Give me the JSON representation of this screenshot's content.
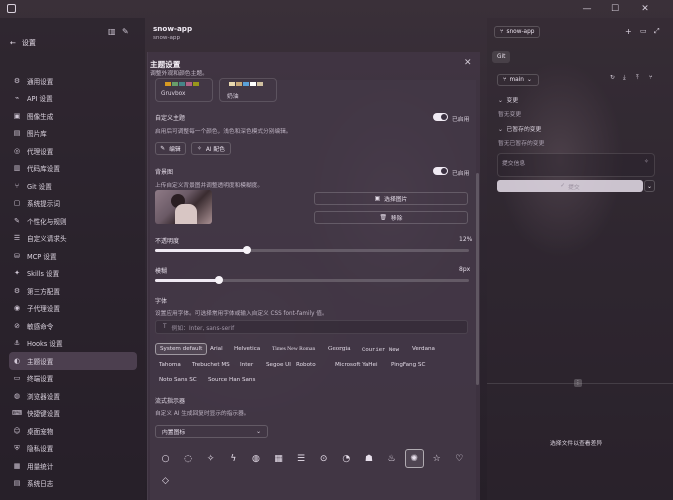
{
  "window": {
    "minimize": "—",
    "maximize": "☐",
    "close": "✕"
  },
  "sidebar": {
    "back_label": "设置",
    "items": [
      {
        "label": "通用设置",
        "icon": "⚙"
      },
      {
        "label": "API 设置",
        "icon": "⌁"
      },
      {
        "label": "图像生成",
        "icon": "▣"
      },
      {
        "label": "图片库",
        "icon": "▤"
      },
      {
        "label": "代理设置",
        "icon": "◎"
      },
      {
        "label": "代码库设置",
        "icon": "▥"
      },
      {
        "label": "Git 设置",
        "icon": "⑂"
      },
      {
        "label": "系统提示词",
        "icon": "▢"
      },
      {
        "label": "个性化与规则",
        "icon": "✎"
      },
      {
        "label": "自定义请求头",
        "icon": "☰"
      },
      {
        "label": "MCP 设置",
        "icon": "⛁"
      },
      {
        "label": "Skills 设置",
        "icon": "✦"
      },
      {
        "label": "第三方配置",
        "icon": "⚙"
      },
      {
        "label": "子代理设置",
        "icon": "◉"
      },
      {
        "label": "敏感命令",
        "icon": "⊘"
      },
      {
        "label": "Hooks 设置",
        "icon": "⚓"
      },
      {
        "label": "主题设置",
        "icon": "◐"
      },
      {
        "label": "终端设置",
        "icon": "▭"
      },
      {
        "label": "浏览器设置",
        "icon": "◍"
      },
      {
        "label": "快捷键设置",
        "icon": "⌨"
      },
      {
        "label": "桌面宠物",
        "icon": "☺"
      },
      {
        "label": "隐私设置",
        "icon": "⛨"
      },
      {
        "label": "用量统计",
        "icon": "▦"
      },
      {
        "label": "系统日志",
        "icon": "▤"
      }
    ],
    "active_index": 16
  },
  "header": {
    "title": "snow-app",
    "subtitle": "snow-app"
  },
  "modal": {
    "title": "主题设置",
    "subtitle": "调整外观和颜色主题。",
    "themes": [
      {
        "name": "Gruvbox",
        "colors": [
          "#d79921",
          "#689d6a",
          "#458588",
          "#b16286",
          "#98971a"
        ]
      },
      {
        "name": "奶油",
        "colors": [
          "#e8d8b0",
          "#c8a878",
          "#5aa0d8",
          "#ffffff",
          "#d0c0a0"
        ]
      }
    ],
    "custom_theme": {
      "label": "自定义主题",
      "status": "已启用",
      "desc": "启用后可调整每一个颜色，浅色和深色模式分别编辑。",
      "edit_label": "编辑",
      "ai_label": "AI 配色"
    },
    "background": {
      "label": "背景图",
      "status": "已启用",
      "desc": "上传自定义背景图并调整透明度和模糊度。",
      "choose_label": "选择图片",
      "remove_label": "移除"
    },
    "opacity": {
      "label": "不透明度",
      "value_text": "12%",
      "value": 12
    },
    "blur": {
      "label": "模糊",
      "value_text": "8px",
      "value": 8,
      "max": 40
    },
    "font": {
      "label": "字体",
      "desc": "设置应用字体。可选择常用字体或输入自定义 CSS font-family 值。",
      "placeholder": "例如：Inter, sans-serif",
      "chips_row1": [
        "System default",
        "Arial",
        "Helvetica",
        "Times New Roman",
        "Georgia",
        "Courier New",
        "Verdana"
      ],
      "chips_row2": [
        "Tahoma",
        "Trebuchet MS",
        "Inter",
        "Segoe UI",
        "Roboto",
        "Microsoft YaHei",
        "PingFang SC"
      ],
      "chips_row3": [
        "Noto Sans SC",
        "Source Han Sans"
      ]
    },
    "indicator": {
      "label": "流式指示器",
      "desc": "自定义 AI 生成回复时显示的指示器。",
      "select_value": "内置图标",
      "icons": [
        "○",
        "◌",
        "✧",
        "ϟ",
        "◍",
        "▦",
        "☰",
        "⊙",
        "◔",
        "☗",
        "♨",
        "✺",
        "☆",
        "♡",
        "◇"
      ],
      "selected_index": 11
    }
  },
  "right_panel": {
    "repo_label": "snow-app",
    "tab_label": "Git",
    "branch": "main",
    "changes_label": "变更",
    "no_changes": "暂无变更",
    "staged_label": "已暂存的变更",
    "no_staged": "暂无已暂存的变更",
    "commit_placeholder": "提交信息",
    "commit_button": "提交",
    "diff_hint": "选择文件以查看差异"
  }
}
